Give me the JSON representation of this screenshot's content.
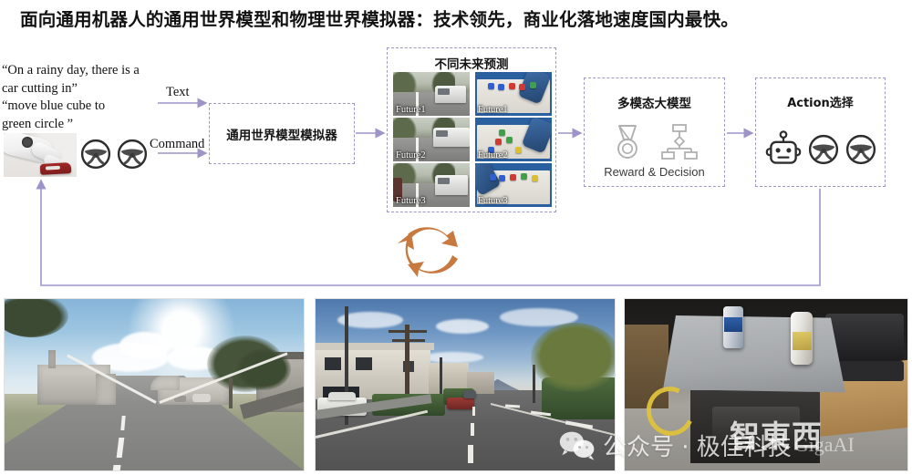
{
  "title": "面向通用机器人的通用世界模型和物理世界模拟器：技术领先，商业化落地速度国内最快。",
  "prompt": {
    "line1": "“On a rainy day, there is a",
    "line2": "car cutting in”",
    "line3": "“move blue cube to",
    "line4": "green circle ”"
  },
  "arrows": {
    "text_label": "Text",
    "command_label": "Command"
  },
  "simulator": {
    "title": "通用世界模型模拟器"
  },
  "future_panel": {
    "title": "不同未来预测",
    "driving": [
      {
        "label": "Future1"
      },
      {
        "label": "Future2"
      },
      {
        "label": "Future3"
      }
    ],
    "manipulation": [
      {
        "label": "Future1"
      },
      {
        "label": "Future2"
      },
      {
        "label": "Future3"
      }
    ]
  },
  "multimodal": {
    "title": "多模态大模型",
    "caption": "Reward  &  Decision",
    "icons": [
      "medal-icon",
      "decision-tree-icon"
    ]
  },
  "action": {
    "title": "Action选择",
    "icons": [
      "robot-head-icon",
      "steering-wheel-icon",
      "steering-wheel-icon"
    ]
  },
  "cycle": {
    "icon": "refresh-cycle-icon"
  },
  "input_icons": [
    "robot-arm-photo",
    "steering-wheel-icon",
    "steering-wheel-icon"
  ],
  "photos": [
    {
      "name": "sunlit-highway-scene"
    },
    {
      "name": "suburban-street-scene"
    },
    {
      "name": "indoor-robot-table-scene"
    }
  ],
  "watermark": {
    "wechat_icon": "wechat-icon",
    "text": "公众号 · 极佳科技",
    "sub": "GigaAI",
    "logo": "智東西"
  },
  "colors": {
    "dashed_border": "#9f97c4",
    "arrow": "#9f94c8",
    "cycle_arrow": "#c8793f",
    "title_text": "#121212"
  }
}
